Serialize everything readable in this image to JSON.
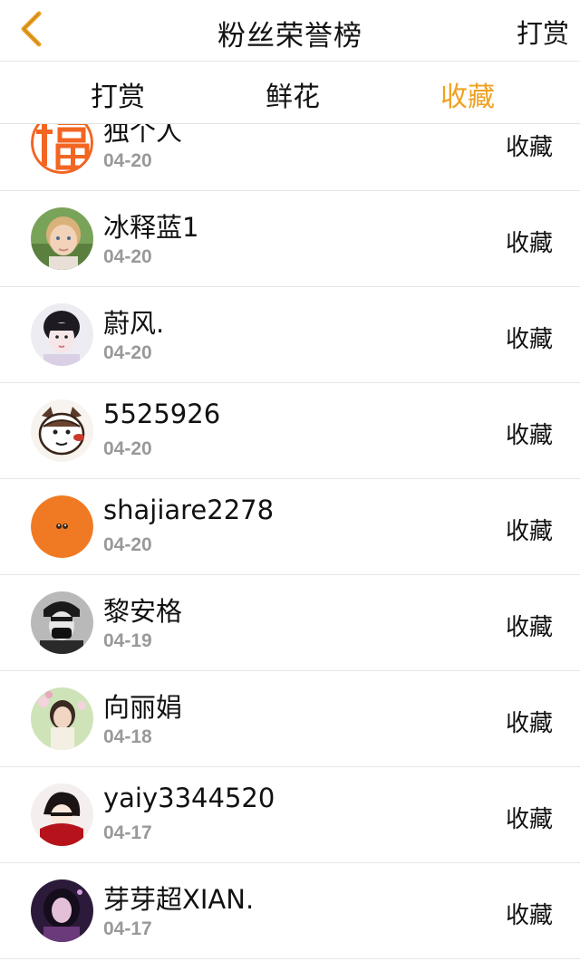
{
  "header": {
    "title": "粉丝荣誉榜",
    "right_label": "打赏",
    "back_icon": "chevron-left-icon",
    "back_color": "#f0a122"
  },
  "tabs": [
    {
      "label": "打赏",
      "active": false
    },
    {
      "label": "鲜花",
      "active": false
    },
    {
      "label": "收藏",
      "active": true
    }
  ],
  "accent_color": "#f0a122",
  "fans": [
    {
      "name": "独个人",
      "date": "04-20",
      "action": "收藏"
    },
    {
      "name": "冰释蓝1",
      "date": "04-20",
      "action": "收藏"
    },
    {
      "name": "蔚风.",
      "date": "04-20",
      "action": "收藏"
    },
    {
      "name": "5525926",
      "date": "04-20",
      "action": "收藏"
    },
    {
      "name": "shajiare2278",
      "date": "04-20",
      "action": "收藏"
    },
    {
      "name": "黎安格",
      "date": "04-19",
      "action": "收藏"
    },
    {
      "name": "向丽娟",
      "date": "04-18",
      "action": "收藏"
    },
    {
      "name": "yaiy3344520",
      "date": "04-17",
      "action": "收藏"
    },
    {
      "name": "芽芽超XIAN.",
      "date": "04-17",
      "action": "收藏"
    }
  ]
}
